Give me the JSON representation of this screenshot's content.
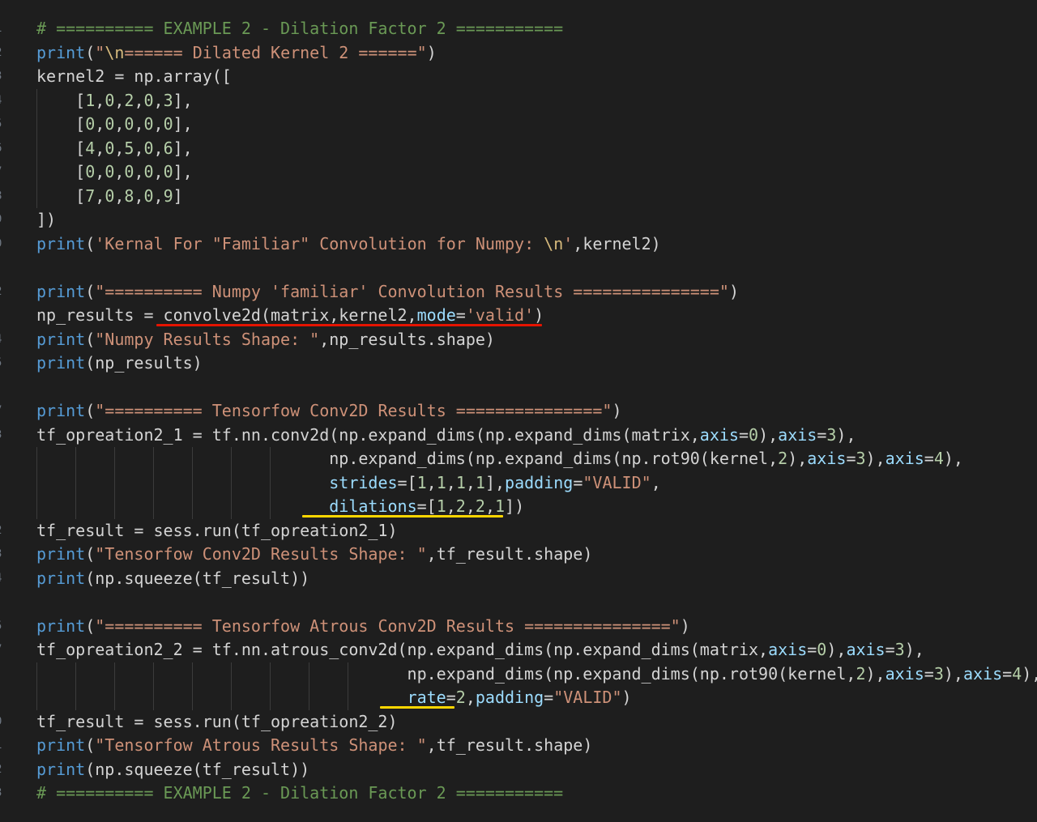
{
  "editor": {
    "language": "python",
    "lines": [
      {
        "gutter": "1",
        "tokens": [
          {
            "t": "# ========== EXAMPLE 2 - Dilation Factor 2 ===========",
            "k": "comment"
          }
        ]
      },
      {
        "gutter": "2",
        "tokens": [
          {
            "t": "print",
            "k": "fn"
          },
          {
            "t": "(",
            "k": "plain"
          },
          {
            "t": "\"",
            "k": "str"
          },
          {
            "t": "\\n",
            "k": "esc"
          },
          {
            "t": "====== Dilated Kernel 2 ======\"",
            "k": "str"
          },
          {
            "t": ")",
            "k": "plain"
          }
        ]
      },
      {
        "gutter": "3",
        "tokens": [
          {
            "t": "kernel2 = np.array([",
            "k": "plain"
          }
        ]
      },
      {
        "gutter": "4",
        "tokens": [
          {
            "t": "    [",
            "k": "plain"
          },
          {
            "t": "1",
            "k": "num"
          },
          {
            "t": ",",
            "k": "plain"
          },
          {
            "t": "0",
            "k": "num"
          },
          {
            "t": ",",
            "k": "plain"
          },
          {
            "t": "2",
            "k": "num"
          },
          {
            "t": ",",
            "k": "plain"
          },
          {
            "t": "0",
            "k": "num"
          },
          {
            "t": ",",
            "k": "plain"
          },
          {
            "t": "3",
            "k": "num"
          },
          {
            "t": "],",
            "k": "plain"
          }
        ]
      },
      {
        "gutter": "5",
        "tokens": [
          {
            "t": "    [",
            "k": "plain"
          },
          {
            "t": "0",
            "k": "num"
          },
          {
            "t": ",",
            "k": "plain"
          },
          {
            "t": "0",
            "k": "num"
          },
          {
            "t": ",",
            "k": "plain"
          },
          {
            "t": "0",
            "k": "num"
          },
          {
            "t": ",",
            "k": "plain"
          },
          {
            "t": "0",
            "k": "num"
          },
          {
            "t": ",",
            "k": "plain"
          },
          {
            "t": "0",
            "k": "num"
          },
          {
            "t": "],",
            "k": "plain"
          }
        ]
      },
      {
        "gutter": "6",
        "tokens": [
          {
            "t": "    [",
            "k": "plain"
          },
          {
            "t": "4",
            "k": "num"
          },
          {
            "t": ",",
            "k": "plain"
          },
          {
            "t": "0",
            "k": "num"
          },
          {
            "t": ",",
            "k": "plain"
          },
          {
            "t": "5",
            "k": "num"
          },
          {
            "t": ",",
            "k": "plain"
          },
          {
            "t": "0",
            "k": "num"
          },
          {
            "t": ",",
            "k": "plain"
          },
          {
            "t": "6",
            "k": "num"
          },
          {
            "t": "],",
            "k": "plain"
          }
        ]
      },
      {
        "gutter": "7",
        "tokens": [
          {
            "t": "    [",
            "k": "plain"
          },
          {
            "t": "0",
            "k": "num"
          },
          {
            "t": ",",
            "k": "plain"
          },
          {
            "t": "0",
            "k": "num"
          },
          {
            "t": ",",
            "k": "plain"
          },
          {
            "t": "0",
            "k": "num"
          },
          {
            "t": ",",
            "k": "plain"
          },
          {
            "t": "0",
            "k": "num"
          },
          {
            "t": ",",
            "k": "plain"
          },
          {
            "t": "0",
            "k": "num"
          },
          {
            "t": "],",
            "k": "plain"
          }
        ]
      },
      {
        "gutter": "8",
        "tokens": [
          {
            "t": "    [",
            "k": "plain"
          },
          {
            "t": "7",
            "k": "num"
          },
          {
            "t": ",",
            "k": "plain"
          },
          {
            "t": "0",
            "k": "num"
          },
          {
            "t": ",",
            "k": "plain"
          },
          {
            "t": "8",
            "k": "num"
          },
          {
            "t": ",",
            "k": "plain"
          },
          {
            "t": "0",
            "k": "num"
          },
          {
            "t": ",",
            "k": "plain"
          },
          {
            "t": "9",
            "k": "num"
          },
          {
            "t": "]",
            "k": "plain"
          }
        ]
      },
      {
        "gutter": "9",
        "tokens": [
          {
            "t": "])",
            "k": "plain"
          }
        ]
      },
      {
        "gutter": "0",
        "tokens": [
          {
            "t": "print",
            "k": "fn"
          },
          {
            "t": "(",
            "k": "plain"
          },
          {
            "t": "'Kernal For \"Familiar\" Convolution for Numpy: ",
            "k": "str"
          },
          {
            "t": "\\n",
            "k": "esc"
          },
          {
            "t": "'",
            "k": "str"
          },
          {
            "t": ",kernel2)",
            "k": "plain"
          }
        ]
      },
      {
        "gutter": "",
        "tokens": []
      },
      {
        "gutter": "2",
        "tokens": [
          {
            "t": "print",
            "k": "fn"
          },
          {
            "t": "(",
            "k": "plain"
          },
          {
            "t": "\"========== Numpy 'familiar' Convolution Results ===============\"",
            "k": "str"
          },
          {
            "t": ")",
            "k": "plain"
          }
        ]
      },
      {
        "gutter": "",
        "tokens": [
          {
            "t": "np_results = convolve2d(matrix,kernel2,",
            "k": "plain"
          },
          {
            "t": "mode",
            "k": "param"
          },
          {
            "t": "=",
            "k": "plain"
          },
          {
            "t": "'valid'",
            "k": "str"
          },
          {
            "t": ")",
            "k": "plain"
          }
        ]
      },
      {
        "gutter": "4",
        "tokens": [
          {
            "t": "print",
            "k": "fn"
          },
          {
            "t": "(",
            "k": "plain"
          },
          {
            "t": "\"Numpy Results Shape: \"",
            "k": "str"
          },
          {
            "t": ",np_results.shape)",
            "k": "plain"
          }
        ]
      },
      {
        "gutter": "5",
        "tokens": [
          {
            "t": "print",
            "k": "fn"
          },
          {
            "t": "(np_results)",
            "k": "plain"
          }
        ]
      },
      {
        "gutter": "",
        "tokens": []
      },
      {
        "gutter": "7",
        "tokens": [
          {
            "t": "print",
            "k": "fn"
          },
          {
            "t": "(",
            "k": "plain"
          },
          {
            "t": "\"========== Tensorfow Conv2D Results ===============\"",
            "k": "str"
          },
          {
            "t": ")",
            "k": "plain"
          }
        ]
      },
      {
        "gutter": "3",
        "tokens": [
          {
            "t": "tf_opreation2_1 = tf.nn.conv2d(np.expand_dims(np.expand_dims(matrix,",
            "k": "plain"
          },
          {
            "t": "axis",
            "k": "param"
          },
          {
            "t": "=",
            "k": "plain"
          },
          {
            "t": "0",
            "k": "num"
          },
          {
            "t": "),",
            "k": "plain"
          },
          {
            "t": "axis",
            "k": "param"
          },
          {
            "t": "=",
            "k": "plain"
          },
          {
            "t": "3",
            "k": "num"
          },
          {
            "t": "),",
            "k": "plain"
          }
        ]
      },
      {
        "gutter": "",
        "tokens": [
          {
            "t": "                              np.expand_dims(np.expand_dims(np.rot90(kernel,",
            "k": "plain"
          },
          {
            "t": "2",
            "k": "num"
          },
          {
            "t": "),",
            "k": "plain"
          },
          {
            "t": "axis",
            "k": "param"
          },
          {
            "t": "=",
            "k": "plain"
          },
          {
            "t": "3",
            "k": "num"
          },
          {
            "t": "),",
            "k": "plain"
          },
          {
            "t": "axis",
            "k": "param"
          },
          {
            "t": "=",
            "k": "plain"
          },
          {
            "t": "4",
            "k": "num"
          },
          {
            "t": "),",
            "k": "plain"
          }
        ]
      },
      {
        "gutter": "",
        "tokens": [
          {
            "t": "                              ",
            "k": "plain"
          },
          {
            "t": "strides",
            "k": "param"
          },
          {
            "t": "=[",
            "k": "plain"
          },
          {
            "t": "1",
            "k": "num"
          },
          {
            "t": ",",
            "k": "plain"
          },
          {
            "t": "1",
            "k": "num"
          },
          {
            "t": ",",
            "k": "plain"
          },
          {
            "t": "1",
            "k": "num"
          },
          {
            "t": ",",
            "k": "plain"
          },
          {
            "t": "1",
            "k": "num"
          },
          {
            "t": "],",
            "k": "plain"
          },
          {
            "t": "padding",
            "k": "param"
          },
          {
            "t": "=",
            "k": "plain"
          },
          {
            "t": "\"VALID\"",
            "k": "str"
          },
          {
            "t": ",",
            "k": "plain"
          }
        ]
      },
      {
        "gutter": "",
        "tokens": [
          {
            "t": "                              ",
            "k": "plain"
          },
          {
            "t": "dilations",
            "k": "param"
          },
          {
            "t": "=[",
            "k": "plain"
          },
          {
            "t": "1",
            "k": "num"
          },
          {
            "t": ",",
            "k": "plain"
          },
          {
            "t": "2",
            "k": "num"
          },
          {
            "t": ",",
            "k": "plain"
          },
          {
            "t": "2",
            "k": "num"
          },
          {
            "t": ",",
            "k": "plain"
          },
          {
            "t": "1",
            "k": "num"
          },
          {
            "t": "])",
            "k": "plain"
          }
        ]
      },
      {
        "gutter": "2",
        "tokens": [
          {
            "t": "tf_result = sess.run(tf_opreation2_1)",
            "k": "plain"
          }
        ]
      },
      {
        "gutter": "3",
        "tokens": [
          {
            "t": "print",
            "k": "fn"
          },
          {
            "t": "(",
            "k": "plain"
          },
          {
            "t": "\"Tensorfow Conv2D Results Shape: \"",
            "k": "str"
          },
          {
            "t": ",tf_result.shape)",
            "k": "plain"
          }
        ]
      },
      {
        "gutter": "4",
        "tokens": [
          {
            "t": "print",
            "k": "fn"
          },
          {
            "t": "(np.squeeze(tf_result))",
            "k": "plain"
          }
        ]
      },
      {
        "gutter": "",
        "tokens": []
      },
      {
        "gutter": "5",
        "tokens": [
          {
            "t": "print",
            "k": "fn"
          },
          {
            "t": "(",
            "k": "plain"
          },
          {
            "t": "\"========== Tensorfow Atrous Conv2D Results ===============\"",
            "k": "str"
          },
          {
            "t": ")",
            "k": "plain"
          }
        ]
      },
      {
        "gutter": "7",
        "tokens": [
          {
            "t": "tf_opreation2_2 = tf.nn.atrous_conv2d(np.expand_dims(np.expand_dims(matrix,",
            "k": "plain"
          },
          {
            "t": "axis",
            "k": "param"
          },
          {
            "t": "=",
            "k": "plain"
          },
          {
            "t": "0",
            "k": "num"
          },
          {
            "t": "),",
            "k": "plain"
          },
          {
            "t": "axis",
            "k": "param"
          },
          {
            "t": "=",
            "k": "plain"
          },
          {
            "t": "3",
            "k": "num"
          },
          {
            "t": "),",
            "k": "plain"
          }
        ]
      },
      {
        "gutter": "",
        "tokens": [
          {
            "t": "                                      np.expand_dims(np.expand_dims(np.rot90(kernel,",
            "k": "plain"
          },
          {
            "t": "2",
            "k": "num"
          },
          {
            "t": "),",
            "k": "plain"
          },
          {
            "t": "axis",
            "k": "param"
          },
          {
            "t": "=",
            "k": "plain"
          },
          {
            "t": "3",
            "k": "num"
          },
          {
            "t": "),",
            "k": "plain"
          },
          {
            "t": "axis",
            "k": "param"
          },
          {
            "t": "=",
            "k": "plain"
          },
          {
            "t": "4",
            "k": "num"
          },
          {
            "t": "),",
            "k": "plain"
          }
        ]
      },
      {
        "gutter": "",
        "tokens": [
          {
            "t": "                                      ",
            "k": "plain"
          },
          {
            "t": "rate",
            "k": "param"
          },
          {
            "t": "=",
            "k": "plain"
          },
          {
            "t": "2",
            "k": "num"
          },
          {
            "t": ",",
            "k": "plain"
          },
          {
            "t": "padding",
            "k": "param"
          },
          {
            "t": "=",
            "k": "plain"
          },
          {
            "t": "\"VALID\"",
            "k": "str"
          },
          {
            "t": ")",
            "k": "plain"
          }
        ]
      },
      {
        "gutter": "0",
        "tokens": [
          {
            "t": "tf_result = sess.run(tf_opreation2_2)",
            "k": "plain"
          }
        ]
      },
      {
        "gutter": "1",
        "tokens": [
          {
            "t": "print",
            "k": "fn"
          },
          {
            "t": "(",
            "k": "plain"
          },
          {
            "t": "\"Tensorfow Atrous Results Shape: \"",
            "k": "str"
          },
          {
            "t": ",tf_result.shape)",
            "k": "plain"
          }
        ]
      },
      {
        "gutter": "2",
        "tokens": [
          {
            "t": "print",
            "k": "fn"
          },
          {
            "t": "(np.squeeze(tf_result))",
            "k": "plain"
          }
        ]
      },
      {
        "gutter": "3",
        "tokens": [
          {
            "t": "# ========== EXAMPLE 2 - Dilation Factor 2 ===========",
            "k": "comment"
          }
        ]
      }
    ]
  },
  "annotations": [
    {
      "name": "red-underline-convolve2d",
      "color": "#e51400"
    },
    {
      "name": "yellow-underline-dilations",
      "color": "#ffd700"
    },
    {
      "name": "yellow-underline-rate",
      "color": "#ffd700"
    }
  ],
  "colors": {
    "background": "#1e1e1e",
    "comment": "#6a9955",
    "function": "#569cd6",
    "string": "#ce9178",
    "escape": "#d7ba7d",
    "number": "#b5cea8",
    "parameter": "#9cdcfe",
    "plain": "#d4d4d4"
  }
}
